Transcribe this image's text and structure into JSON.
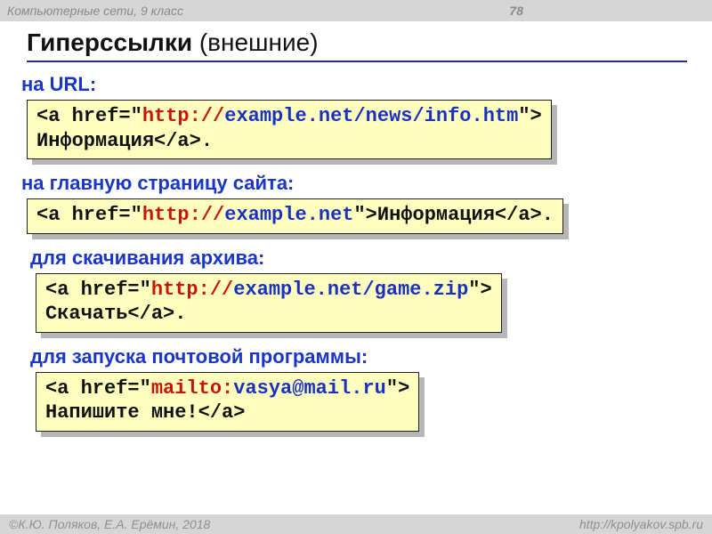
{
  "header": {
    "course": "Компьютерные сети, 9 класс",
    "page_number": "78"
  },
  "title": {
    "bold": "Гиперссылки",
    "paren": " (внешние)"
  },
  "sections": [
    {
      "label": "на URL:",
      "code_lines": [
        [
          {
            "t": "<a href=\"",
            "c": ""
          },
          {
            "t": "http://",
            "c": "c-red"
          },
          {
            "t": "example.net/news/info.htm",
            "c": "c-blue"
          },
          {
            "t": "\">",
            "c": ""
          }
        ],
        [
          {
            "t": "Информация</a>.",
            "c": ""
          }
        ]
      ]
    },
    {
      "label": "на главную страницу сайта:",
      "code_lines": [
        [
          {
            "t": "<a href=\"",
            "c": ""
          },
          {
            "t": "http://",
            "c": "c-red"
          },
          {
            "t": "example.net",
            "c": "c-blue"
          },
          {
            "t": "\">Информация</a>.",
            "c": ""
          }
        ]
      ]
    },
    {
      "label": "для скачивания архива:",
      "code_lines": [
        [
          {
            "t": "<a href=\"",
            "c": ""
          },
          {
            "t": "http://",
            "c": "c-red"
          },
          {
            "t": "example.net/game.zip",
            "c": "c-blue"
          },
          {
            "t": "\">",
            "c": ""
          }
        ],
        [
          {
            "t": "Скачать</a>.",
            "c": ""
          }
        ]
      ]
    },
    {
      "label": "для запуска почтовой программы:",
      "code_lines": [
        [
          {
            "t": "<a href=\"",
            "c": ""
          },
          {
            "t": "mailto:",
            "c": "c-red"
          },
          {
            "t": "vasya@mail.ru",
            "c": "c-blue"
          },
          {
            "t": "\">",
            "c": ""
          }
        ],
        [
          {
            "t": "Напишите мне!</a>",
            "c": ""
          }
        ]
      ]
    }
  ],
  "footer": {
    "left": "©К.Ю. Поляков, Е.А. Ерёмин, 2018",
    "right": "http://kpolyakov.spb.ru"
  }
}
